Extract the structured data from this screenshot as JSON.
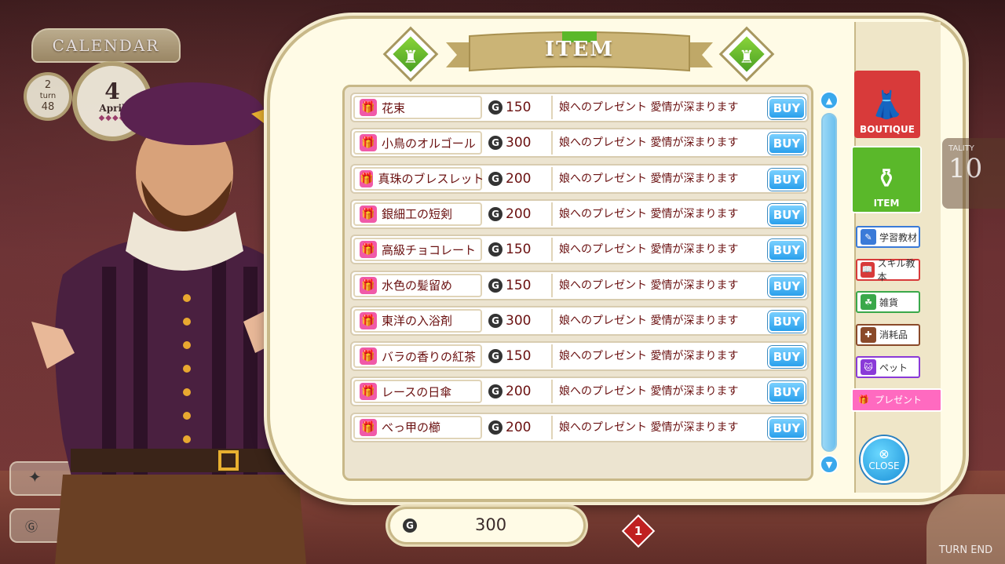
{
  "calendar": {
    "banner": "CALENDAR",
    "turn_current": "2",
    "turn_label": "turn",
    "turn_total": "48",
    "day": "4",
    "month": "April"
  },
  "shop": {
    "title": "ITEM",
    "items": [
      {
        "name": "花束",
        "price": "150",
        "description": "娘へのプレゼント 愛情が深まります",
        "buy_label": "BUY"
      },
      {
        "name": "小鳥のオルゴール",
        "price": "300",
        "description": "娘へのプレゼント 愛情が深まります",
        "buy_label": "BUY"
      },
      {
        "name": "真珠のブレスレット",
        "price": "200",
        "description": "娘へのプレゼント 愛情が深まります",
        "buy_label": "BUY"
      },
      {
        "name": "銀細工の短剣",
        "price": "200",
        "description": "娘へのプレゼント 愛情が深まります",
        "buy_label": "BUY"
      },
      {
        "name": "高級チョコレート",
        "price": "150",
        "description": "娘へのプレゼント 愛情が深まります",
        "buy_label": "BUY"
      },
      {
        "name": "水色の髪留め",
        "price": "150",
        "description": "娘へのプレゼント 愛情が深まります",
        "buy_label": "BUY"
      },
      {
        "name": "東洋の入浴剤",
        "price": "300",
        "description": "娘へのプレゼント 愛情が深まります",
        "buy_label": "BUY"
      },
      {
        "name": "バラの香りの紅茶",
        "price": "150",
        "description": "娘へのプレゼント 愛情が深まります",
        "buy_label": "BUY"
      },
      {
        "name": "レースの日傘",
        "price": "200",
        "description": "娘へのプレゼント 愛情が深まります",
        "buy_label": "BUY"
      },
      {
        "name": "べっ甲の櫛",
        "price": "200",
        "description": "娘へのプレゼント 愛情が深まります",
        "buy_label": "BUY"
      }
    ],
    "currency_symbol": "G"
  },
  "side_tabs": {
    "boutique": "BOUTIQUE",
    "item": "ITEM",
    "categories": [
      {
        "label": "学習教材",
        "icon": "book-stack-icon",
        "color": "#3a7ad8"
      },
      {
        "label": "スキル教本",
        "icon": "open-book-icon",
        "color": "#d83a3a"
      },
      {
        "label": "雑貨",
        "icon": "goods-icon",
        "color": "#3aa84a"
      },
      {
        "label": "消耗品",
        "icon": "capsule-icon",
        "color": "#8a4a2a"
      },
      {
        "label": "ペット",
        "icon": "cat-icon",
        "color": "#8a3ad8"
      },
      {
        "label": "プレゼント",
        "icon": "gift-icon",
        "color": "#ff6ac0"
      }
    ]
  },
  "close": {
    "label": "CLOSE"
  },
  "money": {
    "value": "300"
  },
  "hud": {
    "turn_end": "TURN END",
    "alert_count": "1",
    "vitality_label": "TALITY",
    "vitality_value": "10"
  },
  "colors": {
    "accent_green": "#5ab82a",
    "boutique_red": "#d83a3a",
    "buy_blue": "#2aa0ec",
    "text_red": "#6a1010",
    "panel_cream": "#fffbe6"
  }
}
